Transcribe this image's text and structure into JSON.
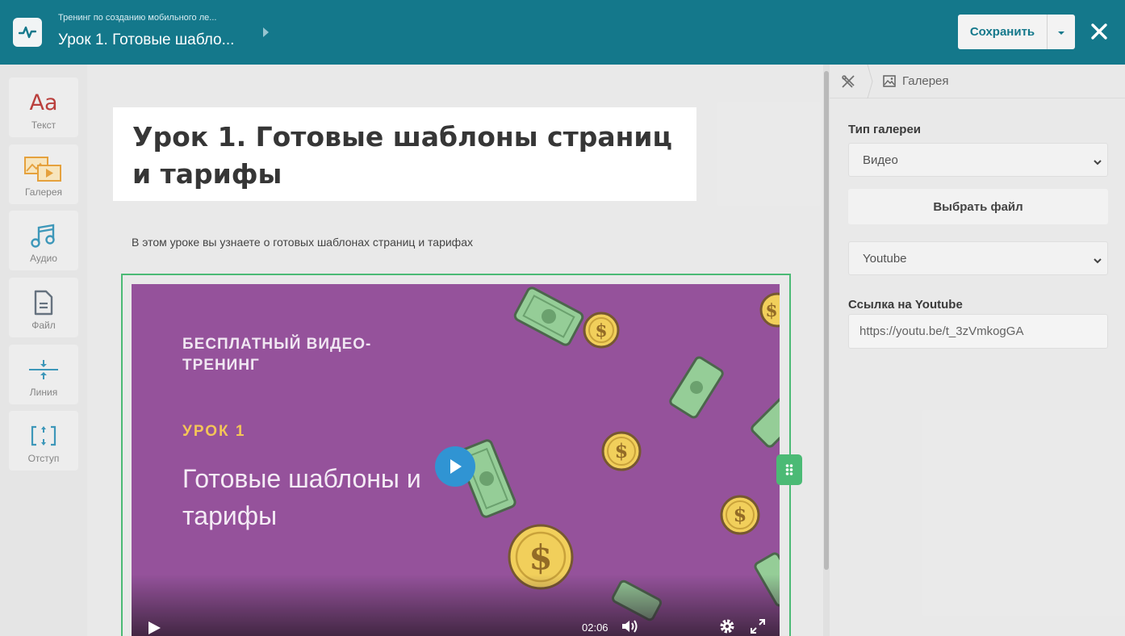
{
  "header": {
    "parent_course": "Тренинг по созданию мобильного ле...",
    "lesson_title": "Урок 1. Готовые шабло...",
    "save_label": "Сохранить",
    "brand_color": "#006d82"
  },
  "toolbar": {
    "items": [
      {
        "label": "Текст",
        "glyph": "Aa",
        "icon": "text-icon"
      },
      {
        "label": "Галерея",
        "icon": "gallery-icon"
      },
      {
        "label": "Аудио",
        "icon": "music-icon"
      },
      {
        "label": "Файл",
        "icon": "file-icon"
      },
      {
        "label": "Линия",
        "icon": "line-icon"
      },
      {
        "label": "Отступ",
        "icon": "spacing-icon"
      }
    ]
  },
  "content": {
    "title": "Урок 1. Готовые шаблоны страниц и тарифы",
    "subtitle": "В этом уроке вы узнаете о готовых шаблонах страниц и тарифах",
    "video": {
      "kicker": "БЕСПЛАТНЫЙ ВИДЕО-ТРЕНИНГ",
      "lesson_number": "УРОК 1",
      "title": "Готовые шаблоны и тарифы",
      "duration": "02:06",
      "background_color": "#8c4493",
      "accent_color": "#f3c04a"
    }
  },
  "panel": {
    "breadcrumb_label": "Галерея",
    "gallery_type_label": "Тип галереи",
    "gallery_type_value": "Видео",
    "choose_file_label": "Выбрать файл",
    "source_value": "Youtube",
    "link_label": "Ссылка на Youtube",
    "link_value": "https://youtu.be/t_3zVmkogGA"
  }
}
